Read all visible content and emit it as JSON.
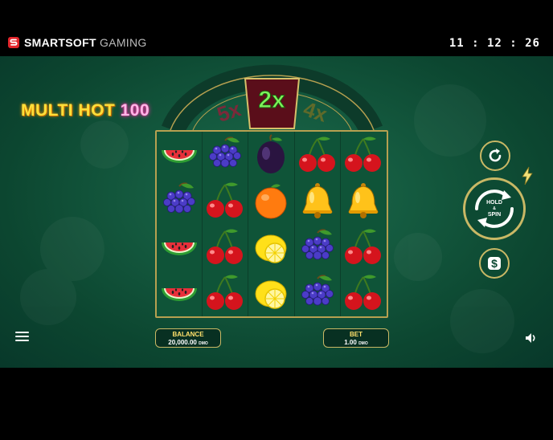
{
  "brand": {
    "name_bold": "SMARTSOFT",
    "name_light": " GAMING"
  },
  "clock": "11 : 12 : 26",
  "game_title": {
    "part1": "MULTI HOT ",
    "part2": "100"
  },
  "multiplier_wheel": {
    "left": "5x",
    "center": "2x",
    "right": "4x"
  },
  "reels": [
    [
      "watermelon",
      "grapes",
      "plum",
      "cherry",
      "cherry"
    ],
    [
      "grapes",
      "cherry",
      "orange",
      "bell",
      "bell"
    ],
    [
      "watermelon",
      "cherry",
      "lemon",
      "grapes",
      "cherry"
    ],
    [
      "watermelon",
      "cherry",
      "lemon",
      "grapes",
      "cherry"
    ]
  ],
  "balance": {
    "label": "BALANCE",
    "amount": "20,000.00",
    "currency": "DMO"
  },
  "bet": {
    "label": "BET",
    "amount": "1.00",
    "currency": "DMO"
  },
  "controls": {
    "spin_label_1": "HOLD",
    "spin_label_2": "&",
    "spin_label_3": "SPIN",
    "autoplay_icon": "refresh-icon",
    "turbo_icon": "lightning-icon",
    "bet_icon": "dollar-icon",
    "menu_icon": "hamburger-icon",
    "sound_icon": "speaker-icon"
  },
  "colors": {
    "accent_gold": "#c9b865",
    "title_yellow": "#ffdf3a",
    "title_pink": "#ff2aa8",
    "felt_green": "#145a3f",
    "brand_red": "#e2252b"
  }
}
